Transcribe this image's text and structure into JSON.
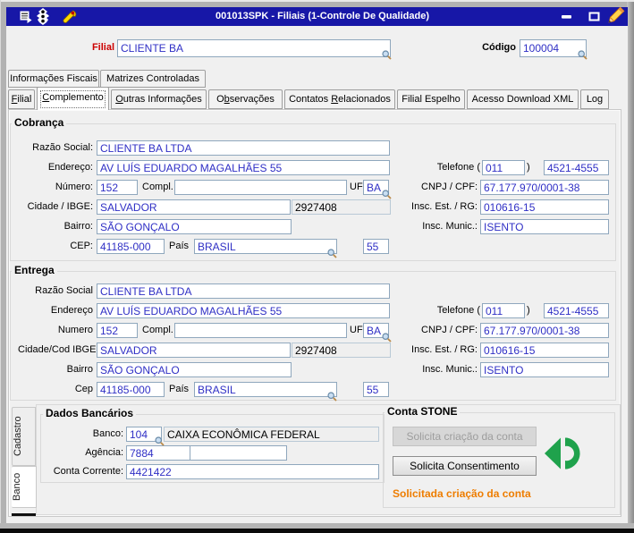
{
  "window": {
    "title": "001013SPK - Filiais (1-Controle De Qualidade)",
    "icons": [
      "form-icon",
      "traffic-light-icon",
      "wrench-icon"
    ],
    "controls": [
      "minimize",
      "maximize",
      "edit-pencil"
    ]
  },
  "colors": {
    "titlebar": "#1717A7",
    "field_text": "#2F2FC5",
    "filial_label": "#CC0000",
    "status_orange": "#EE7D00",
    "stone_green": "#1FA24C"
  },
  "header": {
    "filial_label": "Filial",
    "filial_value": "CLIENTE BA",
    "codigo_label": "Código",
    "codigo_value": "100004"
  },
  "tabs_row1": {
    "fiscais": "Informações Fiscais",
    "matrizes": "Matrizes Controladas"
  },
  "tabs_row2": {
    "filial": "Filial",
    "complemento": "Complemento",
    "outras": "Outras Informações",
    "observacoes": "Observações",
    "contatos": "Contatos Relacionados",
    "espelho": "Filial Espelho",
    "acesso": "Acesso Download XML",
    "log": "Log"
  },
  "active_tab": "Complemento",
  "cobranca": {
    "title": "Cobrança",
    "razao_label": "Razão Social:",
    "razao_value": "CLIENTE BA LTDA",
    "endereco_label": "Endereço:",
    "endereco_value": "AV LUÍS EDUARDO MAGALHÃES 55",
    "numero_label": "Número:",
    "numero_value": "152",
    "compl_label": "Compl.",
    "compl_value": "",
    "uf_label": "UF",
    "uf_value": "BA",
    "cidade_label": "Cidade / IBGE:",
    "cidade_value": "SALVADOR",
    "ibge_value": "2927408",
    "bairro_label": "Bairro:",
    "bairro_value": "SÃO GONÇALO",
    "cep_label": "CEP:",
    "cep_value": "41185-000",
    "pais_label": "País",
    "pais_value": "BRASIL",
    "ddi_value": "55",
    "telefone_label": "Telefone (",
    "telefone_close": ")",
    "ddd_value": "011",
    "fone_value": "4521-4555",
    "cnpj_label": "CNPJ / CPF:",
    "cnpj_value": "67.177.970/0001-38",
    "inscest_label": "Insc. Est. / RG:",
    "inscest_value": "010616-15",
    "inscmun_label": "Insc. Munic.:",
    "inscmun_value": "ISENTO"
  },
  "entrega": {
    "title": "Entrega",
    "razao_label": "Razão Social",
    "razao_value": "CLIENTE BA LTDA",
    "endereco_label": "Endereço",
    "endereco_value": "AV LUÍS EDUARDO MAGALHÃES 55",
    "numero_label": "Numero",
    "numero_value": "152",
    "compl_label": "Compl.",
    "compl_value": "",
    "uf_label": "UF",
    "uf_value": "BA",
    "cidade_label": "Cidade/Cod IBGE",
    "cidade_value": "SALVADOR",
    "ibge_value": "2927408",
    "bairro_label": "Bairro",
    "bairro_value": "SÃO GONÇALO",
    "cep_label": "Cep",
    "cep_value": "41185-000",
    "pais_label": "País",
    "pais_value": "BRASIL",
    "ddi_value": "55",
    "telefone_label": "Telefone (",
    "telefone_close": ")",
    "ddd_value": "011",
    "fone_value": "4521-4555",
    "cnpj_label": "CNPJ / CPF:",
    "cnpj_value": "67.177.970/0001-38",
    "inscest_label": "Insc. Est. / RG:",
    "inscest_value": "010616-15",
    "inscmun_label": "Insc. Munic.:",
    "inscmun_value": "ISENTO"
  },
  "side_tabs": {
    "cadastro": "Cadastro",
    "banco": "Banco"
  },
  "dados_bancarios": {
    "title": "Dados Bancários",
    "banco_label": "Banco:",
    "banco_value": "104",
    "banco_nome": "CAIXA ECONÔMICA FEDERAL",
    "agencia_label": "Agência:",
    "agencia_value": "7884",
    "agencia_extra": "",
    "conta_label": "Conta Corrente:",
    "conta_value": "4421422"
  },
  "conta_stone": {
    "title": "Conta STONE",
    "btn_criacao": "Solicita criação da conta",
    "btn_consentimento": "Solicita Consentimento",
    "status": "Solicitada criação da conta"
  }
}
